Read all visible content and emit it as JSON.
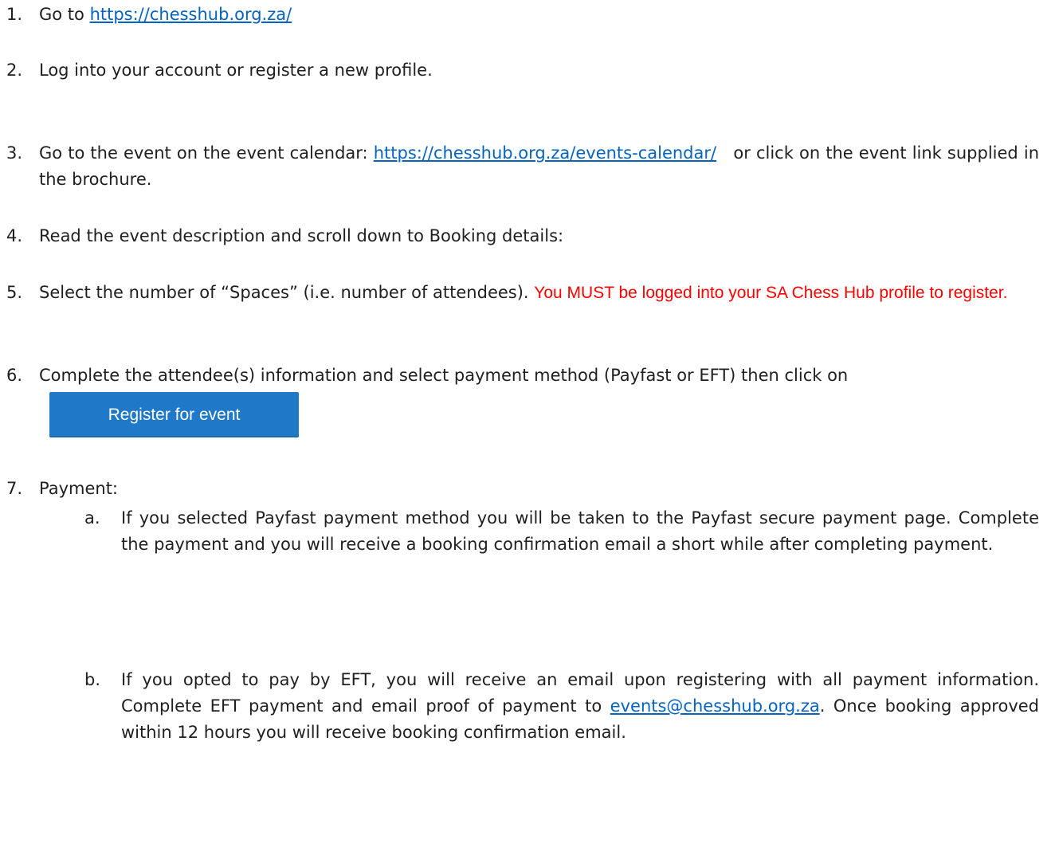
{
  "steps": [
    {
      "num": "1.",
      "prefix": "Go to ",
      "link": "https://chesshub.org.za/"
    },
    {
      "num": "2.",
      "text": "Log into your account or register a new profile."
    },
    {
      "num": "3.",
      "prefix": "Go to the event on the event calendar: ",
      "link": "https://chesshub.org.za/events-calendar/",
      "suffix": "   or click on the event link supplied in the brochure."
    },
    {
      "num": "4.",
      "text": "Read the event description and scroll down to Booking details:"
    },
    {
      "num": "5.",
      "text": "Select the number of “Spaces” (i.e. number of attendees). ",
      "warning": "You MUST be logged into your SA Chess Hub profile to register."
    },
    {
      "num": "6.",
      "text": "Complete the attendee(s) information and select payment method (Payfast or EFT) then click on",
      "button_label": "Register for event"
    },
    {
      "num": "7.",
      "text": "Payment:",
      "substeps": [
        {
          "letter": "a.",
          "text": "If you selected Payfast payment method you will be taken to the Payfast secure payment page. Complete the payment and you will receive a booking confirmation email a short while after completing payment."
        },
        {
          "letter": "b.",
          "prefix": "If you opted to pay by EFT, you will receive an email upon registering with all payment information. Complete EFT payment and email proof of payment to ",
          "link": "events@chesshub.org.za",
          "suffix": ". Once booking approved within 12 hours you will receive booking confirmation email."
        }
      ]
    }
  ],
  "colors": {
    "link": "#0563c1",
    "warning": "#ff0000",
    "button": "#1f78c8"
  }
}
